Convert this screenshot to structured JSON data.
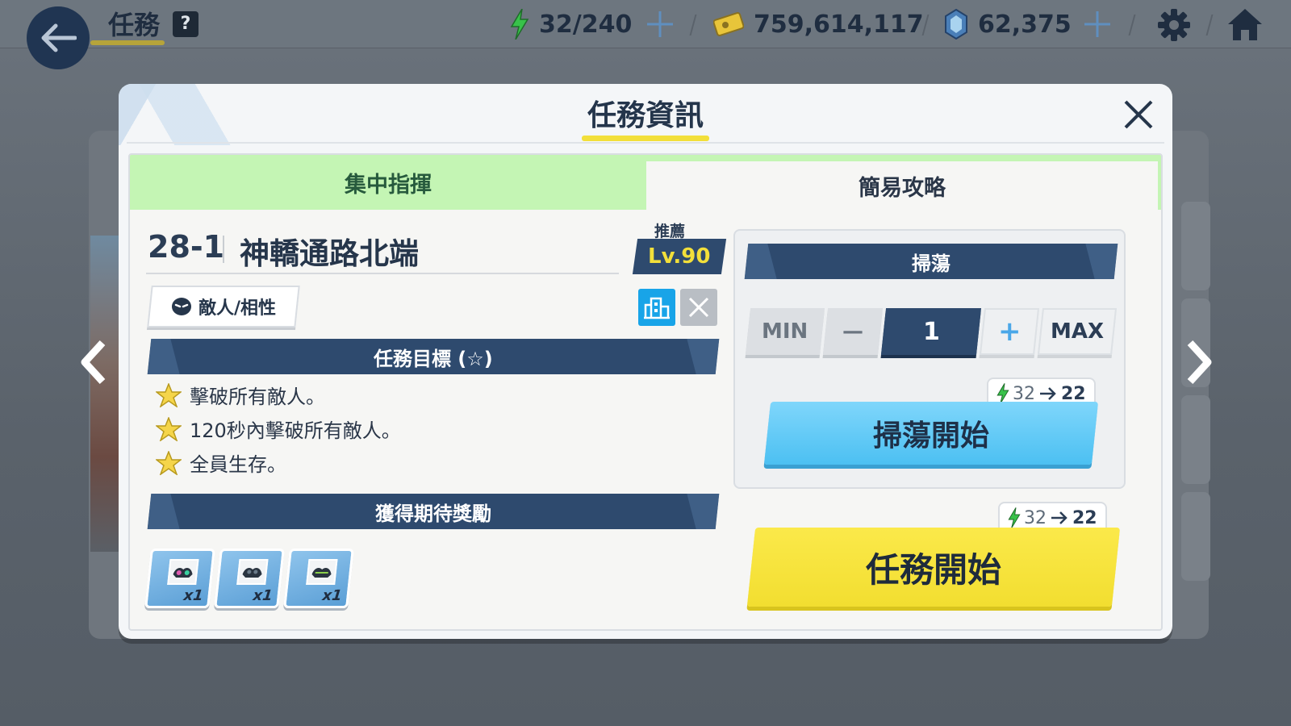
{
  "topbar": {
    "title": "任務",
    "help": "?",
    "ap": "32/240",
    "credits": "759,614,117",
    "gems": "62,375"
  },
  "modal": {
    "title": "任務資訊",
    "tabs": [
      {
        "label": "集中指揮",
        "active": true
      },
      {
        "label": "簡易攻略",
        "active": false
      }
    ],
    "stage_id": "28-1",
    "stage_name": "神轎通路北端",
    "recommend_label": "推薦",
    "recommend_level": "Lv.90",
    "enemy_button": "敵人/相性",
    "objectives_title": "任務目標 (☆)",
    "objectives": [
      "擊破所有敵人。",
      "120秒內擊破所有敵人。",
      "全員生存。"
    ],
    "rewards_title": "獲得期待獎勵",
    "rewards": [
      {
        "qty": "x1"
      },
      {
        "qty": "x1"
      },
      {
        "qty": "x1"
      }
    ],
    "sweep": {
      "title": "掃蕩",
      "min_label": "MIN",
      "minus_label": "—",
      "count": "1",
      "plus_label": "+",
      "max_label": "MAX",
      "cost_from": "32",
      "cost_to": "22",
      "start_label": "掃蕩開始"
    },
    "mission_start": {
      "cost_from": "32",
      "cost_to": "22",
      "label": "任務開始"
    }
  },
  "colors": {
    "accent_yellow": "#f2df3a",
    "navy": "#2e4a6e",
    "tab_green": "#c4f5b4",
    "sweep_blue": "#4cc0f2",
    "ap_green": "#38c24a"
  }
}
